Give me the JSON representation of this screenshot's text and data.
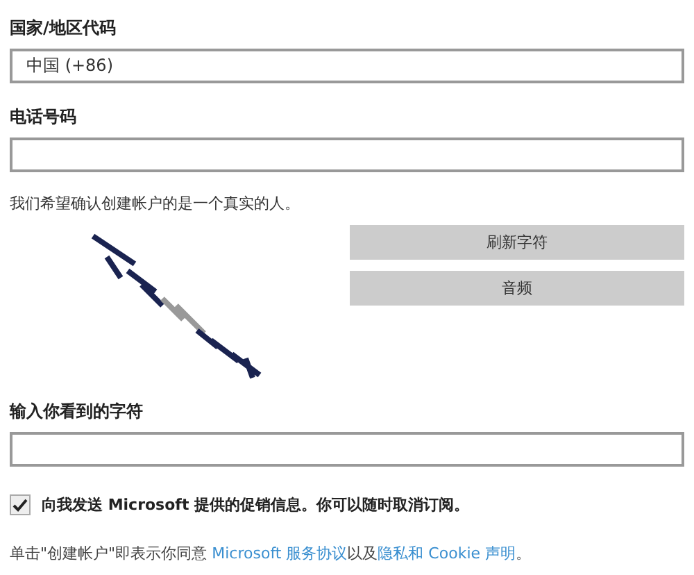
{
  "country": {
    "label": "国家/地区代码",
    "value": "中国 (+86)"
  },
  "phone": {
    "label": "电话号码"
  },
  "captcha": {
    "intro": "我们希望确认创建帐户的是一个真实的人。",
    "kind": "picture",
    "buttons": [
      "刷新字符",
      "音频"
    ],
    "label": "输入你看到的字符"
  },
  "promo": {
    "checked": true,
    "label": "向我发送 Microsoft 提供的促销信息。你可以随时取消订阅。"
  },
  "terms": {
    "parts": [
      {
        "kind": "text",
        "text": "单击\"创建帐户\"即表示你同意 "
      },
      {
        "kind": "link",
        "text": "Microsoft 服务协议"
      },
      {
        "kind": "text",
        "text": "以及"
      },
      {
        "kind": "link",
        "text": "隐私和 Cookie 声明"
      },
      {
        "kind": "text",
        "text": "。"
      }
    ]
  }
}
